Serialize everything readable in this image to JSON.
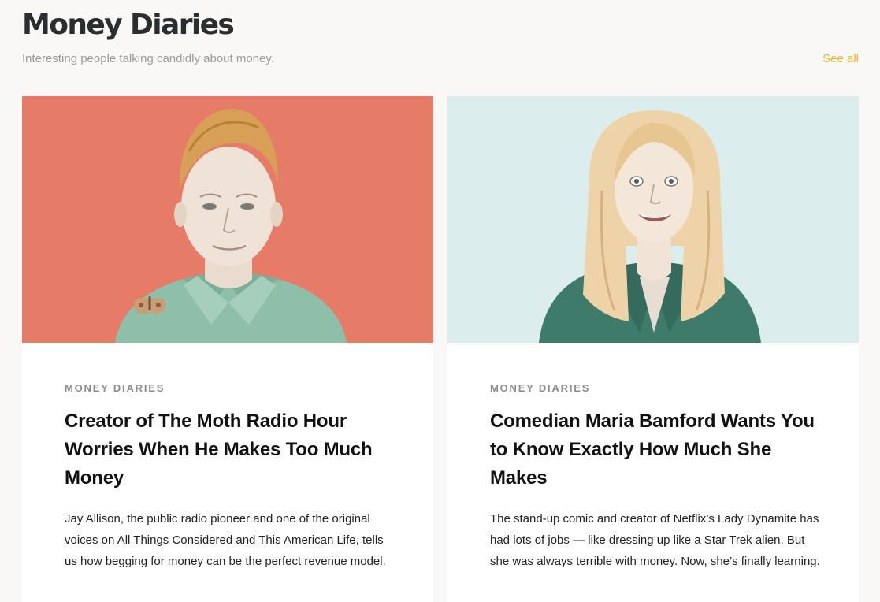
{
  "section": {
    "title": "Money Diaries",
    "subtitle": "Interesting people talking candidly about money.",
    "see_all": "See all"
  },
  "colors": {
    "accent": "#efb32a",
    "card1_bg": "#e67c68",
    "card2_bg": "#dcedee"
  },
  "cards": [
    {
      "kicker": "MONEY DIARIES",
      "headline": "Creator of The Moth Radio Hour Worries When He Makes Too Much Money",
      "dek": "Jay Allison, the public radio pioneer and one of the original voices on All Things Considered and This American Life, tells us how begging for money can be the perfect revenue model.",
      "image": "portrait-illustration-man-with-moth"
    },
    {
      "kicker": "MONEY DIARIES",
      "headline": "Comedian Maria Bamford Wants You to Know Exactly How Much She Makes",
      "dek": "The stand-up comic and creator of Netflix’s Lady Dynamite has had lots of jobs — like dressing up like a Star Trek alien. But she was always terrible with money. Now, she’s finally learning.",
      "image": "portrait-illustration-woman-blonde"
    }
  ]
}
